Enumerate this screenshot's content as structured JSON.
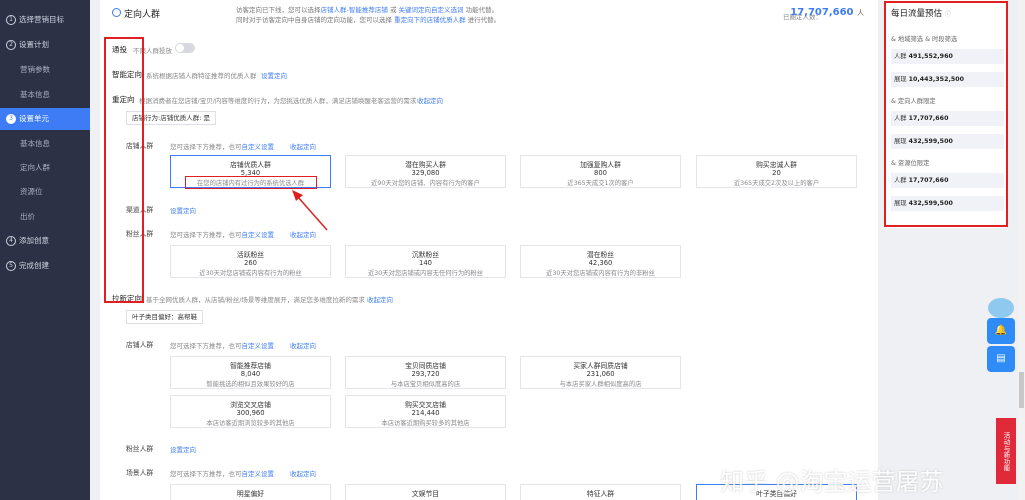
{
  "sidebar": {
    "items": [
      {
        "num": "1",
        "label": "选择营销目标",
        "type": "step"
      },
      {
        "num": "2",
        "label": "设置计划",
        "type": "step"
      },
      {
        "label": "营销参数",
        "type": "sub"
      },
      {
        "label": "基本信息",
        "type": "sub"
      },
      {
        "num": "3",
        "label": "设置单元",
        "type": "step",
        "active": true
      },
      {
        "label": "基本信息",
        "type": "sub"
      },
      {
        "label": "定向人群",
        "type": "sub"
      },
      {
        "label": "资源位",
        "type": "sub"
      },
      {
        "label": "出价",
        "type": "sub"
      },
      {
        "num": "4",
        "label": "添加创意",
        "type": "step"
      },
      {
        "num": "5",
        "label": "完成创建",
        "type": "step"
      }
    ]
  },
  "header": {
    "title": "定向人群",
    "notice_a": "访客定向已下线，您可以选择",
    "notice_link1": "店铺人群-智能推荐店铺",
    "notice_b": "或",
    "notice_link2": "关键词定向自定义选词",
    "notice_c": "功能代替。",
    "notice_d": "同时对于访客定向中自身店铺的定向功能，您可以选择",
    "notice_link3": "重定向下的店铺优质人群",
    "notice_e": "进行代替。",
    "count_label": "已圈定人数：",
    "count_value": "17,707,660",
    "count_unit": "人"
  },
  "tongtou": {
    "label": "通投",
    "note": "不限人群投放"
  },
  "smart": {
    "label": "智能定向",
    "note": "系统根据店铺人群特征推荐的优质人群",
    "link": "设置定向"
  },
  "retarget": {
    "label": "重定向",
    "note": "根据消费者在您店铺/宝贝/内容等维度的行为，为您挑选优质人群，满足店铺唤醒老客运营的需求",
    "link": "收起定向",
    "tag": "店铺行为:店铺优质人群: 是",
    "store_label": "店铺人群",
    "store_note": "您可选择下方推荐，也可",
    "store_custom": "自定义设置",
    "store_link": "收起定向",
    "store_cards": [
      {
        "title": "店铺优质人群",
        "value": "5,340",
        "desc": "在您的店铺内有过行为的系统优选人群"
      },
      {
        "title": "潜在购买人群",
        "value": "329,080",
        "desc": "近90天对您的店铺、内容有行为的客户"
      },
      {
        "title": "加强复购人群",
        "value": "800",
        "desc": "近365天成交1次的客户"
      },
      {
        "title": "购买忠诚人群",
        "value": "20",
        "desc": "近365天成交2次及以上的客户"
      }
    ],
    "channel_label": "渠道人群",
    "channel_link": "设置定向",
    "fans_label": "粉丝人群",
    "fans_note": "您可选择下方推荐，也可",
    "fans_custom": "自定义设置",
    "fans_link": "收起定向",
    "fans_cards": [
      {
        "title": "活跃粉丝",
        "value": "260",
        "desc": "近30天对您店铺或内容有行为的粉丝"
      },
      {
        "title": "沉默粉丝",
        "value": "140",
        "desc": "近30天对您店铺或内容无任何行为的粉丝"
      },
      {
        "title": "潜在粉丝",
        "value": "42,360",
        "desc": "近30天对您店铺或内容有行为的非粉丝"
      }
    ]
  },
  "expand": {
    "label": "拉新定向",
    "note": "基于全网优质人群，从店铺/粉丝/场景等维度展开，满足您多维度拉新的需求",
    "link": "收起定向",
    "tag": "叶子类目偏好：高帮鞋",
    "store_label": "店铺人群",
    "store_note": "您可选择下方推荐，也可",
    "store_custom": "自定义设置",
    "store_link": "收起定向",
    "store_cards": [
      {
        "title": "智能推荐店铺",
        "value": "8,040",
        "desc": "智能挑选的相似且效果较好的店"
      },
      {
        "title": "宝贝同质店铺",
        "value": "293,720",
        "desc": "与本店宝贝相似度高的店"
      },
      {
        "title": "买家人群同质店铺",
        "value": "231,060",
        "desc": "与本店买家人群相似度高的店"
      },
      {
        "title": "浏览交叉店铺",
        "value": "300,960",
        "desc": "本店访客近期浏览较多的其他店"
      },
      {
        "title": "购买交叉店铺",
        "value": "214,440",
        "desc": "本店访客近期购买较多的其他店"
      }
    ],
    "fans_label": "粉丝人群",
    "fans_link": "设置定向",
    "scene_label": "场景人群",
    "scene_note": "您可选择下方推荐，也可",
    "scene_custom": "自定义设置",
    "scene_link": "收起定向",
    "scene_cards": [
      {
        "title": "明星偏好"
      },
      {
        "title": "文娱节目"
      },
      {
        "title": "特征人群"
      },
      {
        "title": "叶子类目偏好"
      }
    ]
  },
  "panel": {
    "title": "每日流量预估",
    "sections": [
      {
        "label": "& 地域筛选 & 时段筛选",
        "rows": [
          {
            "k": "人群",
            "v": "491,552,960"
          },
          {
            "k": "展现",
            "v": "10,443,352,500"
          }
        ]
      },
      {
        "label": "& 定向人群限定",
        "rows": [
          {
            "k": "人群",
            "v": "17,707,660"
          },
          {
            "k": "展现",
            "v": "432,599,500"
          }
        ]
      },
      {
        "label": "& 资源位限定",
        "rows": [
          {
            "k": "人群",
            "v": "17,707,660"
          },
          {
            "k": "展现",
            "v": "432,599,500"
          }
        ]
      }
    ]
  },
  "promo": "活动与新功能",
  "watermark": "知乎 @淘宝运营屠苏"
}
